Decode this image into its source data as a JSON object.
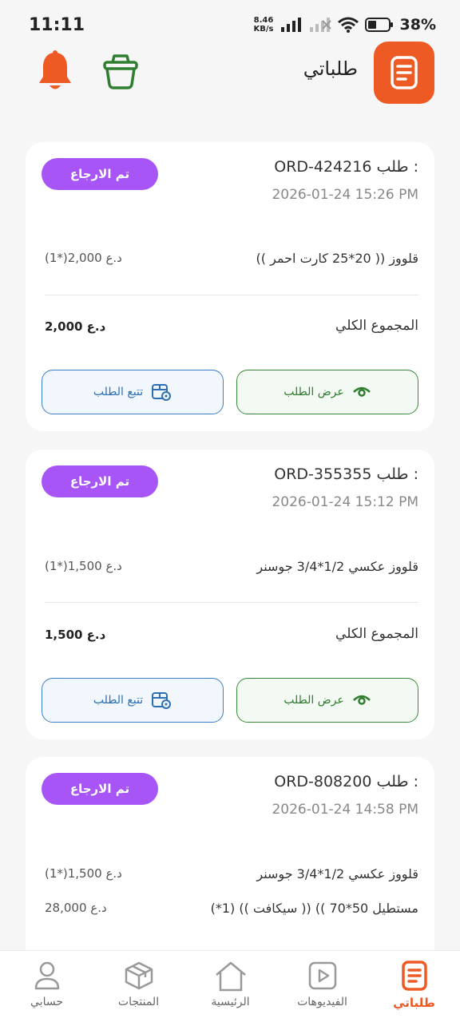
{
  "status_bar": {
    "time": "11:11",
    "net_speed_value": "8.46",
    "net_speed_unit": "KB/s",
    "battery": "38%"
  },
  "header": {
    "title": "طلباتي",
    "title_icon": "orders-document-icon",
    "notification_icon": "bell-icon",
    "basket_icon": "basket-icon"
  },
  "orders": [
    {
      "status": "تم الارجاع",
      "order_label": "طلب :",
      "order_id": "ORD-424216",
      "date": "2026-01-24 15:26 PM",
      "items": [
        {
          "name": "قلووز (( 20*25 كارت احمر ))",
          "price": "(1*)2,000 د.ع"
        }
      ],
      "total_label": "المجموع الكلي",
      "total": "2,000 د.ع",
      "view_button": "عرض الطلب",
      "track_button": "تتبع الطلب"
    },
    {
      "status": "تم الارجاع",
      "order_label": "طلب :",
      "order_id": "ORD-355355",
      "date": "2026-01-24 15:12 PM",
      "items": [
        {
          "name": "قلووز عكسي 1/2*3/4 جوسنر",
          "price": "(1*)1,500 د.ع"
        }
      ],
      "total_label": "المجموع الكلي",
      "total": "1,500 د.ع",
      "view_button": "عرض الطلب",
      "track_button": "تتبع الطلب"
    },
    {
      "status": "تم الارجاع",
      "order_label": "طلب :",
      "order_id": "ORD-808200",
      "date": "2026-01-24 14:58 PM",
      "items": [
        {
          "name": "قلووز عكسي 1/2*3/4 جوسنر",
          "price": "(1*)1,500 د.ع"
        },
        {
          "name": "مستطيل 50*70 )) (( سيكافت ))  (1*)",
          "price": "28,000 د.ع"
        }
      ]
    }
  ],
  "bottom_nav": [
    {
      "label": "طلباتي",
      "icon": "orders-icon",
      "active": true
    },
    {
      "label": "الفيديوهات",
      "icon": "video-icon",
      "active": false
    },
    {
      "label": "الرئيسية",
      "icon": "home-icon",
      "active": false
    },
    {
      "label": "المنتجات",
      "icon": "box-icon",
      "active": false
    },
    {
      "label": "حسابي",
      "icon": "user-icon",
      "active": false
    }
  ],
  "colors": {
    "brand_orange": "#ee5a24",
    "status_purple": "#a855f7",
    "view_green": "#3b8a3b",
    "track_blue": "#3c7fc4"
  }
}
